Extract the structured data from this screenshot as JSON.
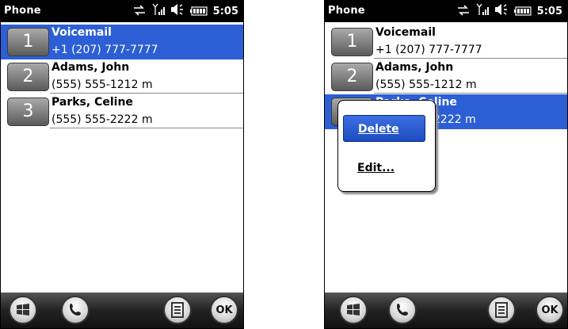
{
  "app_title": "Phone",
  "clock": "5:05",
  "contacts": [
    {
      "speed_dial": "1",
      "name": "Voicemail",
      "number": "+1 (207) 777-7777"
    },
    {
      "speed_dial": "2",
      "name": "Adams, John",
      "number": "(555) 555-1212 m"
    },
    {
      "speed_dial": "3",
      "name": "Parks, Celine",
      "number": "(555) 555-2222 m"
    }
  ],
  "right_truncated_number": "2222 m",
  "context_menu": {
    "delete": "Delete",
    "edit": "Edit..."
  },
  "softkeys": {
    "ok": "OK"
  },
  "icons": [
    "sync-icon",
    "signal-icon",
    "volume-icon",
    "battery-icon",
    "windows-start-icon",
    "phone-icon",
    "menu-icon"
  ],
  "colors": {
    "selection": "#2c5ed6",
    "statusbar": "#000000"
  }
}
